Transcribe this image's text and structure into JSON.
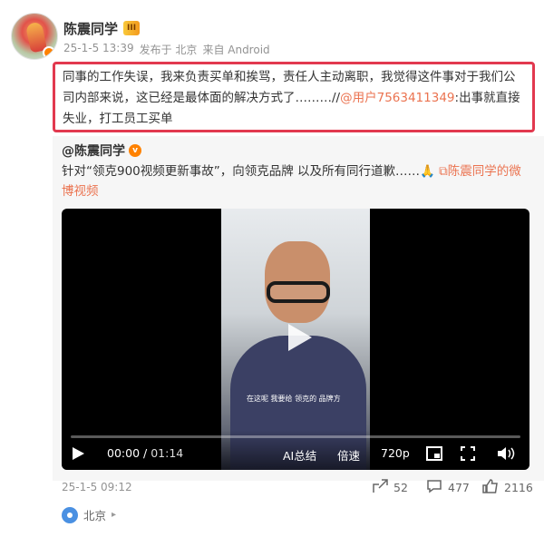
{
  "post": {
    "author": "陈震同学",
    "vip_badge": "III",
    "timestamp": "25-1-5 13:39",
    "location": "发布于 北京",
    "source": "来自 Android",
    "text_part1": "同事的工作失误，我来负责买单和挨骂，责任人主动离职，我觉得这件事对于我们公司内部来说，这已经是最体面的解决方式了………//",
    "mention": "@用户7563411349",
    "text_part2": ":出事就直接失业，打工员工买单"
  },
  "repost": {
    "author": "@陈震同学",
    "text": "针对“领克900视频更新事故”，向领克品牌 以及所有同行道歉……🙏",
    "video_link": "陈震同学的微博视频",
    "video": {
      "subtitle": "在这呢 我要给 领克的 品牌方",
      "current_time": "00:00",
      "duration": "01:14",
      "ai_label": "AI总结",
      "speed_label": "倍速",
      "quality_label": "720p",
      "progress": 0.0
    },
    "footer_time": "25-1-5 09:12",
    "reposts": "52",
    "comments": "477",
    "likes": "2116",
    "location": "北京"
  },
  "colors": {
    "accent": "#eb7350",
    "highlight_border": "#e2394f",
    "meta_text": "#939393"
  }
}
